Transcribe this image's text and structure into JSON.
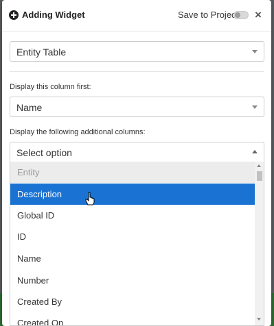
{
  "header": {
    "title": "Adding Widget",
    "save_to_project_label": "Save to Project",
    "save_to_project_enabled": false
  },
  "widget_type": {
    "selected": "Entity Table"
  },
  "first_column": {
    "label": "Display this column first:",
    "selected": "Name"
  },
  "additional_columns": {
    "label": "Display the following additional columns:",
    "placeholder": "Select option",
    "options": [
      {
        "label": "Entity",
        "disabled": true
      },
      {
        "label": "Description",
        "highlighted": true
      },
      {
        "label": "Global ID"
      },
      {
        "label": "ID"
      },
      {
        "label": "Name"
      },
      {
        "label": "Number"
      },
      {
        "label": "Created By"
      },
      {
        "label": "Created On"
      }
    ]
  },
  "colors": {
    "highlight": "#1a73d2",
    "disabled_bg": "#ececec"
  },
  "icons": [
    "plus-circle-icon",
    "toggle-switch",
    "close-icon",
    "chevron-down-icon",
    "chevron-up-icon",
    "hand-pointer-cursor"
  ]
}
